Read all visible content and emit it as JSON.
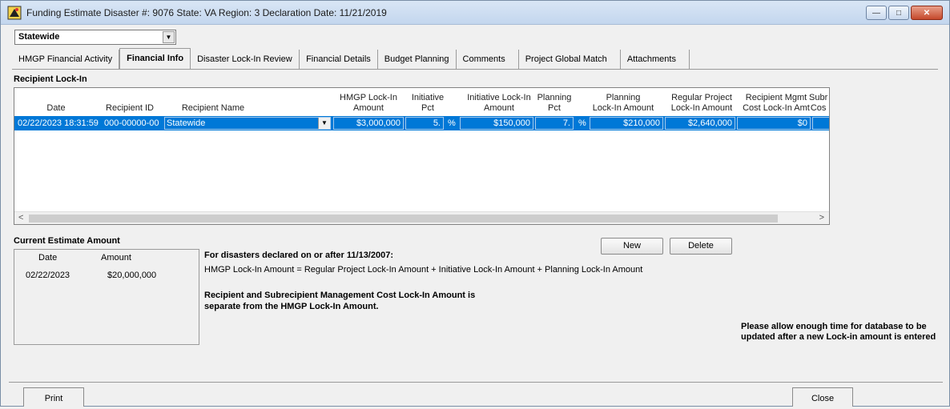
{
  "window": {
    "title": "Funding Estimate  Disaster #: 9076  State: VA  Region: 3  Declaration Date: 11/21/2019",
    "minimize": "—",
    "maximize": "□",
    "close": "✕"
  },
  "scope_select": {
    "value": "Statewide"
  },
  "tabs": [
    {
      "label": "HMGP Financial Activity"
    },
    {
      "label": "Financial Info"
    },
    {
      "label": "Disaster Lock-In Review"
    },
    {
      "label": "Financial Details"
    },
    {
      "label": "Budget Planning"
    },
    {
      "label": "Comments"
    },
    {
      "label": "Project Global Match"
    },
    {
      "label": "Attachments"
    }
  ],
  "recipient_lockin": {
    "label": "Recipient Lock-In",
    "columns": {
      "date": "Date",
      "recipient_id": "Recipient ID",
      "recipient_name": "Recipient Name",
      "hmgp_lockin": "HMGP Lock-In\nAmount",
      "initiative_pct": "Initiative\nPct",
      "initiative_lockin": "Initiative Lock-In\nAmount",
      "planning_pct": "Planning\nPct",
      "planning_lockin": "Planning\nLock-In Amount",
      "regular_lockin": "Regular Project\nLock-In Amount",
      "recipient_mgmt": "Recipient Mgmt\nCost Lock-In Amt",
      "subr": "Subr\nCos"
    },
    "row": {
      "date": "02/22/2023 18:31:59",
      "recipient_id": "000-00000-00",
      "recipient_name": "Statewide",
      "hmgp_lockin": "$3,000,000",
      "initiative_pct": "5.",
      "pct_symbol": "%",
      "initiative_lockin": "$150,000",
      "planning_pct": "7.",
      "planning_lockin": "$210,000",
      "regular_lockin": "$2,640,000",
      "recipient_mgmt": "$0"
    }
  },
  "current_estimate": {
    "label": "Current Estimate Amount",
    "col_date": "Date",
    "col_amount": "Amount",
    "date": "02/22/2023",
    "amount": "$20,000,000"
  },
  "buttons": {
    "new": "New",
    "delete": "Delete",
    "print": "Print",
    "close": "Close"
  },
  "info": {
    "heading": "For disasters declared on or after 11/13/2007:",
    "formula": "HMGP Lock-In Amount = Regular Project Lock-In Amount + Initiative Lock-In Amount + Planning Lock-In Amount",
    "note1": "Recipient and Subrecipient Management Cost Lock-In Amount is",
    "note2": "separate from the HMGP Lock-In Amount.",
    "wait1": "Please allow enough time for database to be",
    "wait2": "updated after a new Lock-in amount is entered"
  }
}
